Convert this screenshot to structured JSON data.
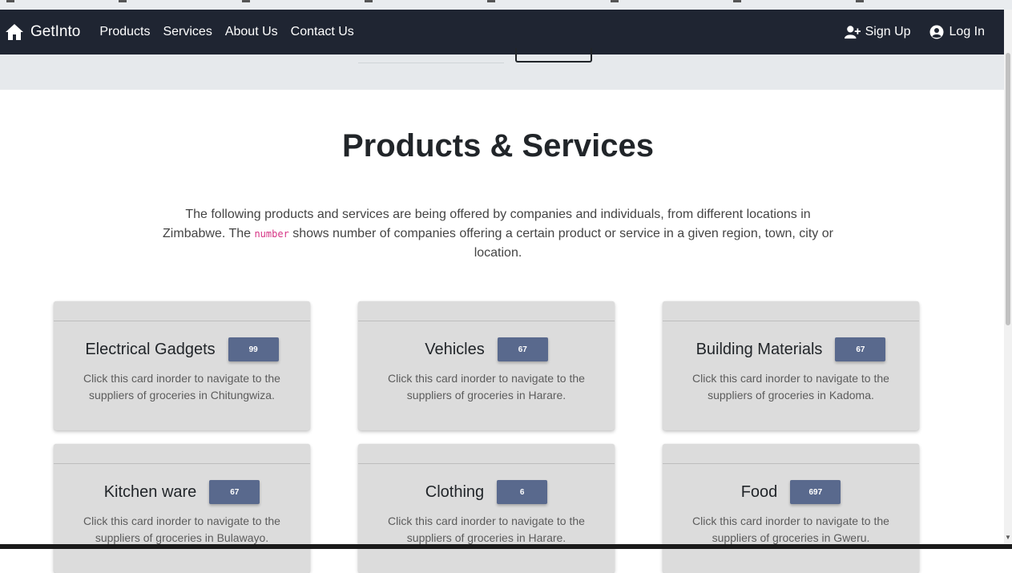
{
  "navbar": {
    "brand": "GetInto",
    "links": [
      "Products",
      "Services",
      "About Us",
      "Contact Us"
    ],
    "signup": "Sign Up",
    "login": "Log In"
  },
  "section": {
    "title": "Products & Services",
    "desc_before": "The following products and services are being offered by companies and individuals, from different locations in Zimbabwe. The ",
    "desc_code": "number",
    "desc_after": " shows number of companies offering a certain product or service in a given region, town, city or location."
  },
  "cards": [
    {
      "title": "Electrical Gadgets",
      "count": "99",
      "text": "Click this card inorder to navigate to the suppliers of groceries in Chitungwiza."
    },
    {
      "title": "Vehicles",
      "count": "67",
      "text": "Click this card inorder to navigate to the suppliers of groceries in Harare."
    },
    {
      "title": "Building Materials",
      "count": "67",
      "text": "Click this card inorder to navigate to the suppliers of groceries in Kadoma."
    },
    {
      "title": "Kitchen ware",
      "count": "67",
      "text": "Click this card inorder to navigate to the suppliers of groceries in Bulawayo."
    },
    {
      "title": "Clothing",
      "count": "6",
      "text": "Click this card inorder to navigate to the suppliers of groceries in Harare."
    },
    {
      "title": "Food",
      "count": "697",
      "text": "Click this card inorder to navigate to the suppliers of groceries in Gweru."
    }
  ],
  "colors": {
    "navbar": "#1f2532",
    "badge": "#59698d",
    "card": "#dcdcdc",
    "code": "#d63384"
  },
  "icons": {
    "brand": "home-icon",
    "signup": "user-plus-icon",
    "login": "user-circle-icon"
  }
}
